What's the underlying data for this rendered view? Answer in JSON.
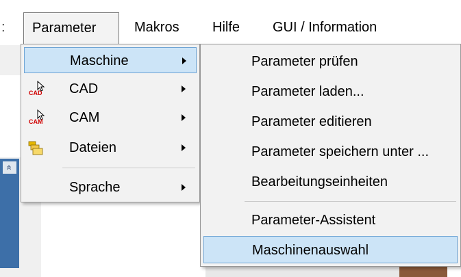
{
  "menubar": {
    "colon": ":",
    "items": [
      {
        "label": "Parameter"
      },
      {
        "label": "Makros"
      },
      {
        "label": "Hilfe"
      },
      {
        "label": "GUI / Information"
      }
    ]
  },
  "parameter_menu": {
    "items": [
      {
        "label": "Maschine",
        "icon": "none"
      },
      {
        "label": "CAD",
        "icon": "cad-icon",
        "icon_text": "CAD"
      },
      {
        "label": "CAM",
        "icon": "cam-icon",
        "icon_text": "CAM"
      },
      {
        "label": "Dateien",
        "icon": "folders-icon"
      },
      {
        "label": "Sprache",
        "icon": "none"
      }
    ]
  },
  "maschine_submenu": {
    "items": [
      {
        "label": "Parameter prüfen"
      },
      {
        "label": "Parameter laden..."
      },
      {
        "label": "Parameter editieren"
      },
      {
        "label": "Parameter speichern unter ..."
      },
      {
        "label": "Bearbeitungseinheiten"
      },
      {
        "label": "Parameter-Assistent"
      },
      {
        "label": "Maschinenauswahl"
      }
    ]
  },
  "background": {
    "collapse_button_glyph": "«"
  },
  "colors": {
    "highlight": "#cce4f7",
    "highlight_border": "#6da3d4",
    "menu_bg": "#f2f2f2",
    "icon_red": "#d00000"
  }
}
